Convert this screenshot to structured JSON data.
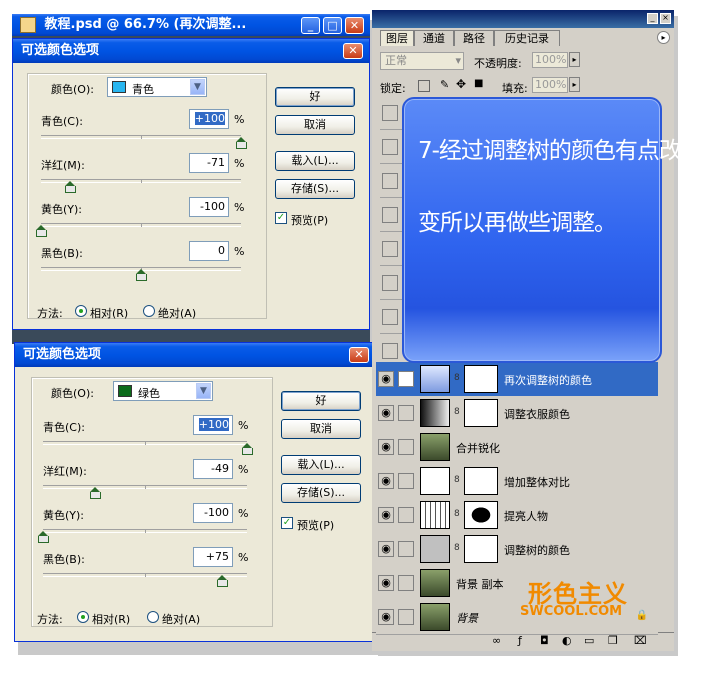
{
  "doc_window": {
    "title": "教程.psd @ 66.7% (再次调整...",
    "min_glyph": "_",
    "max_glyph": "□",
    "close_glyph": "✕"
  },
  "dialog1": {
    "title": "可选颜色选项",
    "close_glyph": "✕",
    "color_label": "颜色(O):",
    "color_value": "青色",
    "color_swatch": "#29b6f0",
    "rows": [
      {
        "label": "青色(C):",
        "value": "+100",
        "percent": 1.0
      },
      {
        "label": "洋红(M):",
        "value": "-71",
        "percent": -0.71
      },
      {
        "label": "黄色(Y):",
        "value": "-100",
        "percent": -1.0
      },
      {
        "label": "黑色(B):",
        "value": "0",
        "percent": 0.0
      }
    ],
    "unit": "%",
    "ok": "好",
    "cancel": "取消",
    "load": "载入(L)...",
    "save": "存储(S)...",
    "preview": "预览(P)",
    "method_label": "方法:",
    "relative": "相对(R)",
    "absolute": "绝对(A)"
  },
  "dialog2": {
    "title": "可选颜色选项",
    "close_glyph": "✕",
    "color_label": "颜色(O):",
    "color_value": "绿色",
    "color_swatch": "#0b6b1a",
    "rows": [
      {
        "label": "青色(C):",
        "value": "+100",
        "percent": 1.0
      },
      {
        "label": "洋红(M):",
        "value": "-49",
        "percent": -0.49
      },
      {
        "label": "黄色(Y):",
        "value": "-100",
        "percent": -1.0
      },
      {
        "label": "黑色(B):",
        "value": "+75",
        "percent": 0.75
      }
    ],
    "unit": "%",
    "ok": "好",
    "cancel": "取消",
    "load": "载入(L)...",
    "save": "存储(S)...",
    "preview": "预览(P)",
    "method_label": "方法:",
    "relative": "相对(R)",
    "absolute": "绝对(A)"
  },
  "layers_panel": {
    "tabs": [
      "图层",
      "通道",
      "路径",
      "历史记录"
    ],
    "blend_mode": "正常",
    "opacity_label": "不透明度:",
    "opacity_value": "100%",
    "lock_label": "锁定:",
    "fill_label": "填充:",
    "fill_value": "100%",
    "layers": [
      {
        "name": "再次调整树的颜色",
        "active": true
      },
      {
        "name": "调整衣服颜色",
        "active": false
      },
      {
        "name": "合并锐化",
        "active": false
      },
      {
        "name": "增加整体对比",
        "active": false
      },
      {
        "name": "提亮人物",
        "active": false
      },
      {
        "name": "调整树的颜色",
        "active": false
      },
      {
        "name": "背景 副本",
        "active": false
      },
      {
        "name": "背景",
        "active": false
      }
    ]
  },
  "note_card": {
    "text_line1": "7-经过调整树的颜色有点改",
    "text_line2": "变所以再做些调整。"
  },
  "watermark": {
    "logo": "形色主义",
    "url": "SWCOOL.COM"
  }
}
